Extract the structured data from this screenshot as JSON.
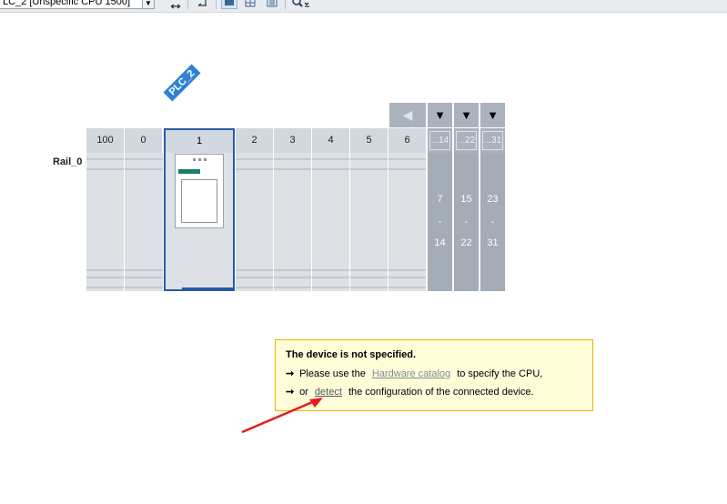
{
  "toolbar": {
    "device_selector": "LC_2 [Unspecific CPU 1500]"
  },
  "plc": {
    "name": "PLC_2"
  },
  "rail": {
    "label": "Rail_0",
    "slots": [
      "100",
      "0",
      "1",
      "2",
      "3",
      "4",
      "5",
      "6"
    ],
    "expansion_headers": [
      "...14",
      "...22",
      "...31"
    ],
    "expansion_ranges": [
      {
        "from": "7",
        "dash": "-",
        "to": "14"
      },
      {
        "from": "15",
        "dash": "-",
        "to": "22"
      },
      {
        "from": "23",
        "dash": "-",
        "to": "31"
      }
    ]
  },
  "info": {
    "title": "The device is not specified.",
    "line1_prefix": "Please use the",
    "line1_link": "Hardware catalog",
    "line1_suffix": "to specify the CPU,",
    "line2_prefix": "or",
    "line2_link": "detect",
    "line2_suffix": "the configuration of the connected device."
  },
  "colors": {
    "selection": "#2a5aa6",
    "info_bg": "#fffcd8",
    "info_border": "#f0b400",
    "annotation_arrow": "#e51b1b"
  },
  "icons": [
    "dropdown-arrow-icon",
    "swap-icon",
    "import-icon",
    "network-icon",
    "grid-icon",
    "list-icon",
    "zoom-icon",
    "nav-left-icon",
    "expand-down-icon"
  ]
}
